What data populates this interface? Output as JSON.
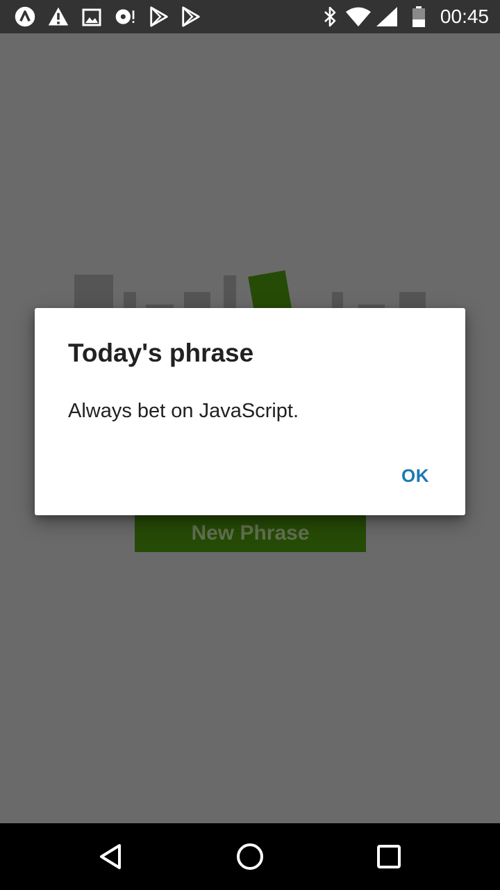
{
  "status_bar": {
    "time": "00:45",
    "left_icons": [
      "app-logo-icon",
      "warning-icon",
      "image-icon",
      "music-disc-icon",
      "play-store-icon",
      "play-store-icon"
    ],
    "right_icons": [
      "bluetooth-icon",
      "wifi-icon",
      "signal-icon",
      "battery-icon"
    ]
  },
  "app": {
    "button_label": "New Phrase",
    "accent_color": "#264b06"
  },
  "dialog": {
    "title": "Today's phrase",
    "message": "Always bet on JavaScript.",
    "ok_label": "OK",
    "ok_color": "#1e78b4"
  },
  "nav_bar": {
    "icons": [
      "back-icon",
      "home-icon",
      "recents-icon"
    ]
  }
}
